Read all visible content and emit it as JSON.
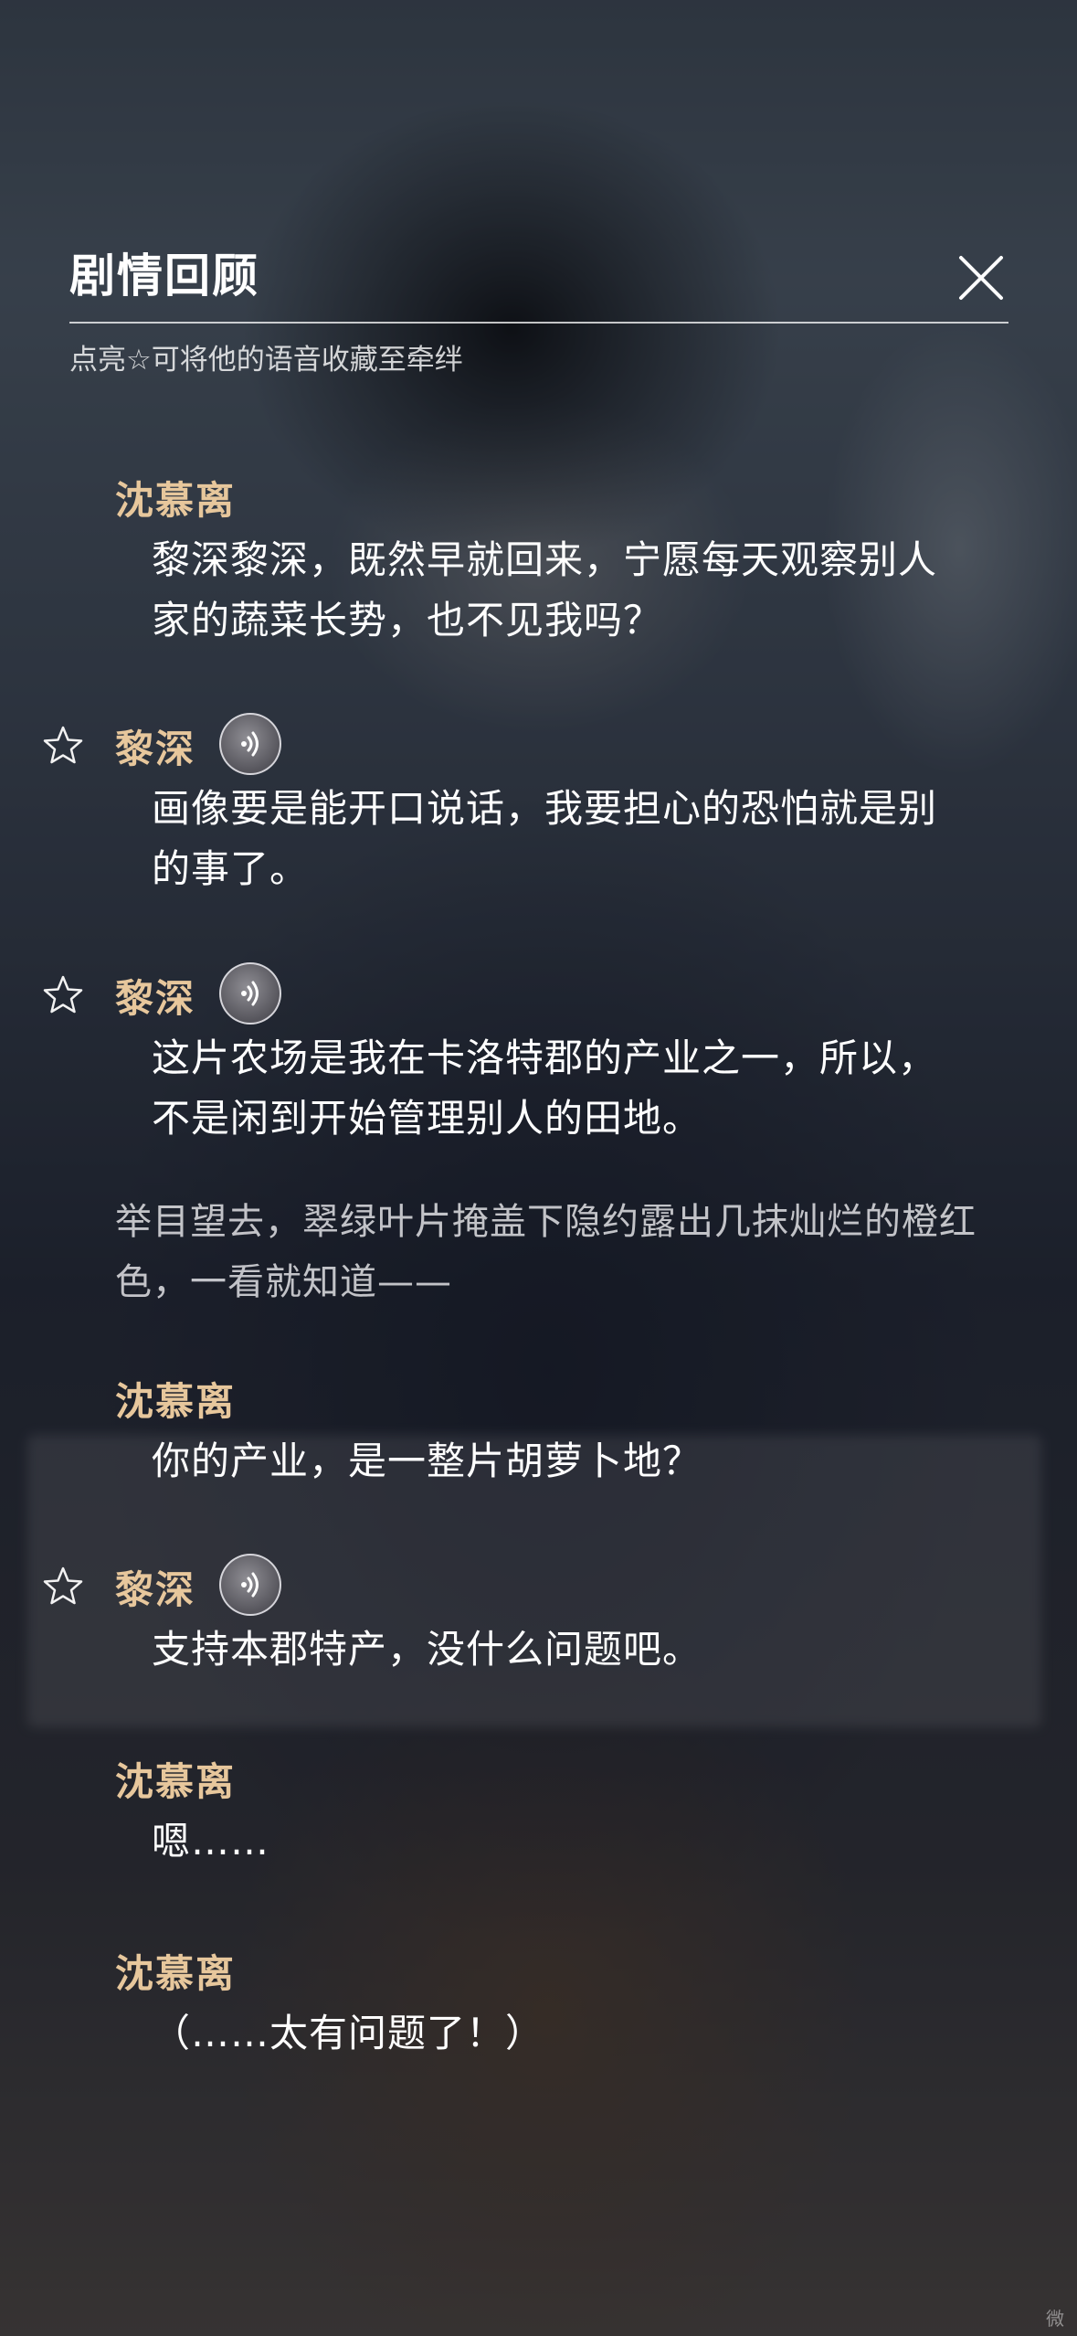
{
  "header": {
    "title": "剧情回顾",
    "subtitle": "点亮☆可将他的语音收藏至牵绊"
  },
  "entries": [
    {
      "speaker": "沈慕离",
      "text": "黎深黎深，既然早就回来，宁愿每天观察别人家的蔬菜长势，也不见我吗？",
      "has_voice": false
    },
    {
      "speaker": "黎深",
      "text": "画像要是能开口说话，我要担心的恐怕就是别的事了。",
      "has_voice": true
    },
    {
      "speaker": "黎深",
      "text": "这片农场是我在卡洛特郡的产业之一，所以，不是闲到开始管理别人的田地。",
      "has_voice": true
    },
    {
      "narration": "举目望去，翠绿叶片掩盖下隐约露出几抹灿烂的橙红色，一看就知道——"
    },
    {
      "speaker": "沈慕离",
      "text": "你的产业，是一整片胡萝卜地？",
      "has_voice": false
    },
    {
      "speaker": "黎深",
      "text": "支持本郡特产，没什么问题吧。",
      "has_voice": true
    },
    {
      "speaker": "沈慕离",
      "text": "嗯……",
      "has_voice": false
    },
    {
      "speaker": "沈慕离",
      "text": "（……太有问题了！）",
      "has_voice": false
    }
  ],
  "icons": {
    "close": "close-icon",
    "star": "star-outline-icon",
    "voice": "voice-play-icon"
  },
  "colors": {
    "speaker_name": "#e7c79c",
    "dialogue_text": "#ffffff",
    "narration_text": "#e1e1e4"
  },
  "corner_mark": "微"
}
